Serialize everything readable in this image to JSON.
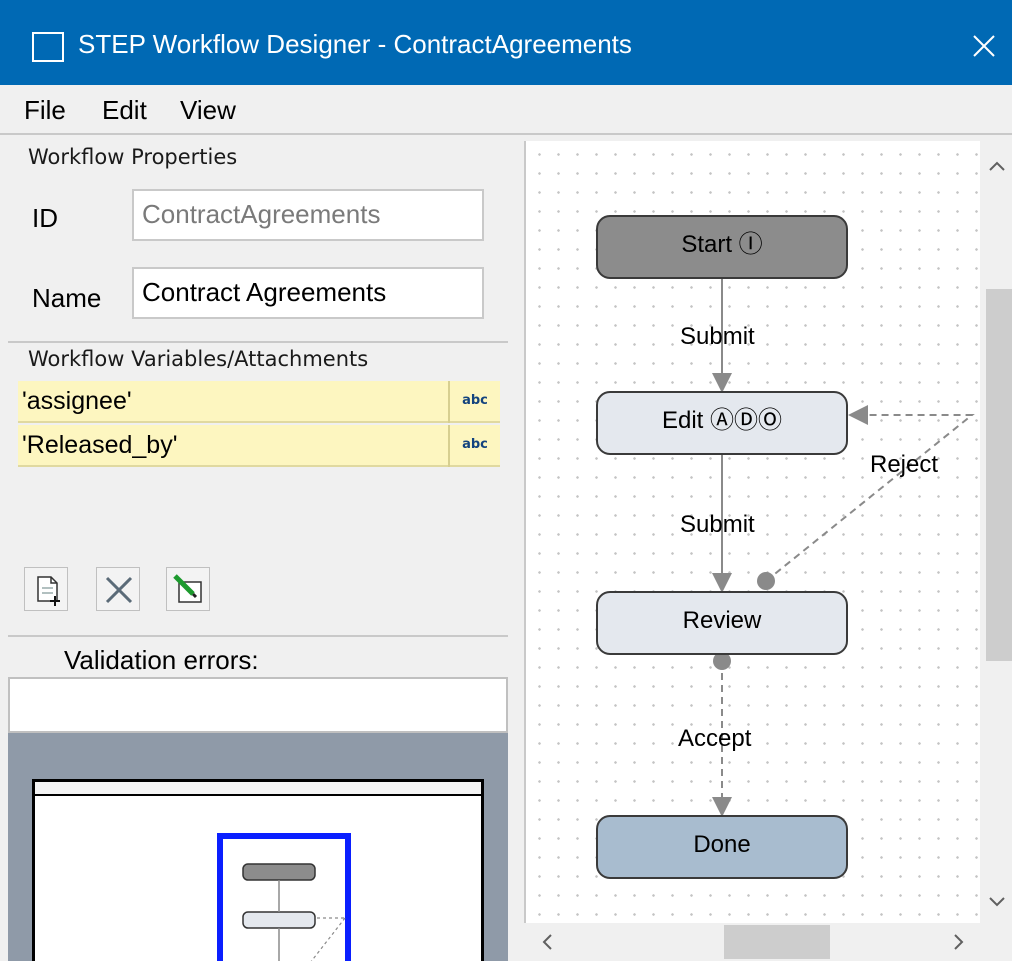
{
  "window": {
    "title": "STEP Workflow Designer - ContractAgreements",
    "close_glyph": "✕"
  },
  "menu": {
    "file": "File",
    "edit": "Edit",
    "view": "View"
  },
  "properties": {
    "section_title": "Workflow Properties",
    "id_label": "ID",
    "id_value": "ContractAgreements",
    "name_label": "Name",
    "name_value": "Contract Agreements"
  },
  "variables": {
    "section_title": "Workflow Variables/Attachments",
    "items": [
      {
        "name": "'assignee'",
        "type_icon": "abc"
      },
      {
        "name": "'Released_by'",
        "type_icon": "abc"
      }
    ]
  },
  "toolbar": {
    "add_icon": "add-variable-icon",
    "delete_icon": "delete-variable-icon",
    "edit_icon": "edit-variable-icon"
  },
  "validation": {
    "label": "Validation errors:",
    "value": ""
  },
  "diagram": {
    "nodes": {
      "start": "Start Ⓘ",
      "edit": "Edit ⒶⒹⓄ",
      "review": "Review",
      "done": "Done"
    },
    "edges": {
      "submit_1": "Submit",
      "submit_2": "Submit",
      "reject": "Reject",
      "accept": "Accept"
    },
    "colors": {
      "start_fill": "#8c8c8c",
      "task_fill": "#e4e8ee",
      "done_fill": "#a8bccf",
      "edge": "#8a8a8a"
    }
  },
  "scrollbars": {
    "up": "^",
    "down": "v",
    "left": "<",
    "right": ">"
  }
}
